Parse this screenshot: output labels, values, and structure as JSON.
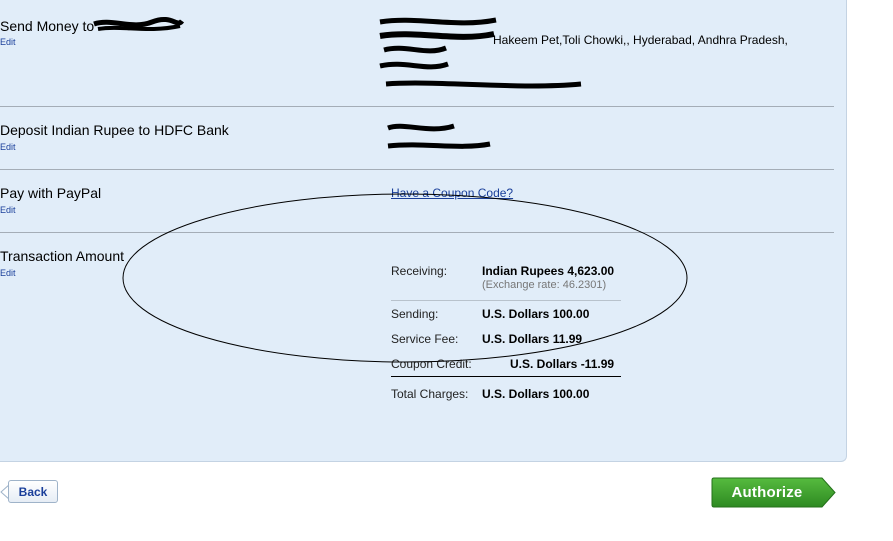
{
  "sections": {
    "send_money": {
      "title": "Send Money to",
      "edit": "Edit"
    },
    "deposit": {
      "title": "Deposit Indian Rupee to HDFC Bank",
      "edit": "Edit"
    },
    "pay": {
      "title": "Pay with PayPal",
      "edit": "Edit",
      "coupon_link": "Have a Coupon Code?"
    },
    "transaction": {
      "title": "Transaction Amount",
      "edit": "Edit"
    }
  },
  "recipient_address_fragment": "Hakeem Pet,Toli Chowki,, Hyderabad, Andhra Pradesh,",
  "amounts": {
    "receiving_label": "Receiving:",
    "receiving_value": "Indian Rupees 4,623.00",
    "exchange_rate": "(Exchange rate: 46.2301)",
    "sending_label": "Sending:",
    "sending_value": "U.S. Dollars 100.00",
    "fee_label": "Service Fee:",
    "fee_value": "U.S. Dollars 11.99",
    "coupon_label": "Coupon Credit:",
    "coupon_value": "U.S. Dollars -11.99",
    "total_label": "Total Charges:",
    "total_value": "U.S. Dollars 100.00"
  },
  "buttons": {
    "back": "Back",
    "authorize": "Authorize"
  },
  "colors": {
    "panel": "#e1edf9",
    "link": "#1a3f9a",
    "authorize": "#3a9a2a"
  }
}
